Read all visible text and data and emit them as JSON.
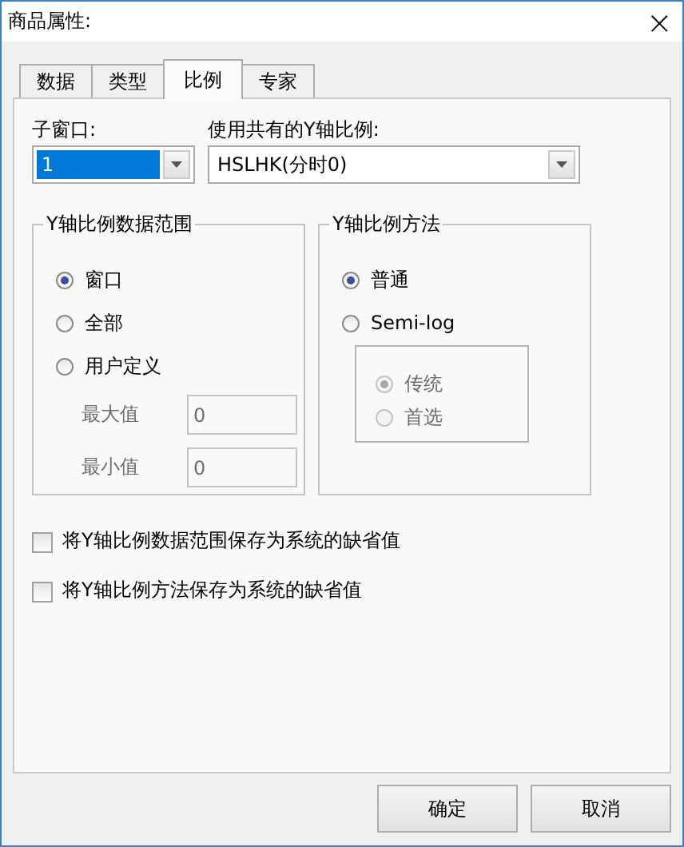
{
  "window": {
    "title": "商品属性:",
    "close": "×"
  },
  "tabs": [
    {
      "label": "数据",
      "selected": false
    },
    {
      "label": "类型",
      "selected": false
    },
    {
      "label": "比例",
      "selected": true
    },
    {
      "label": "专家",
      "selected": false
    }
  ],
  "subwindow": {
    "label": "子窗口:",
    "value": "1",
    "selected": true
  },
  "shared_scale": {
    "label": "使用共有的Y轴比例:",
    "value": "HSLHK(分时0)",
    "selected": false
  },
  "range_group": {
    "title": "Y轴比例数据范围",
    "options": [
      {
        "label": "窗口",
        "selected": true
      },
      {
        "label": "全部",
        "selected": false
      },
      {
        "label": "用户定义",
        "selected": false
      }
    ],
    "fields": [
      {
        "label": "最大值",
        "value": "0",
        "disabled": true
      },
      {
        "label": "最小值",
        "value": "0",
        "disabled": true
      }
    ]
  },
  "method_group": {
    "title": "Y轴比例方法",
    "options": [
      {
        "label": "普通",
        "selected": true
      },
      {
        "label": "Semi-log",
        "selected": false
      }
    ],
    "sub_options": [
      {
        "label": "传统",
        "selected": true,
        "disabled": true
      },
      {
        "label": "首选",
        "selected": false,
        "disabled": true
      }
    ]
  },
  "checkboxes": [
    {
      "label": "将Y轴比例数据范围保存为系统的缺省值",
      "checked": false
    },
    {
      "label": "将Y轴比例方法保存为系统的缺省值",
      "checked": false
    }
  ],
  "buttons": [
    "确定",
    "取消"
  ]
}
